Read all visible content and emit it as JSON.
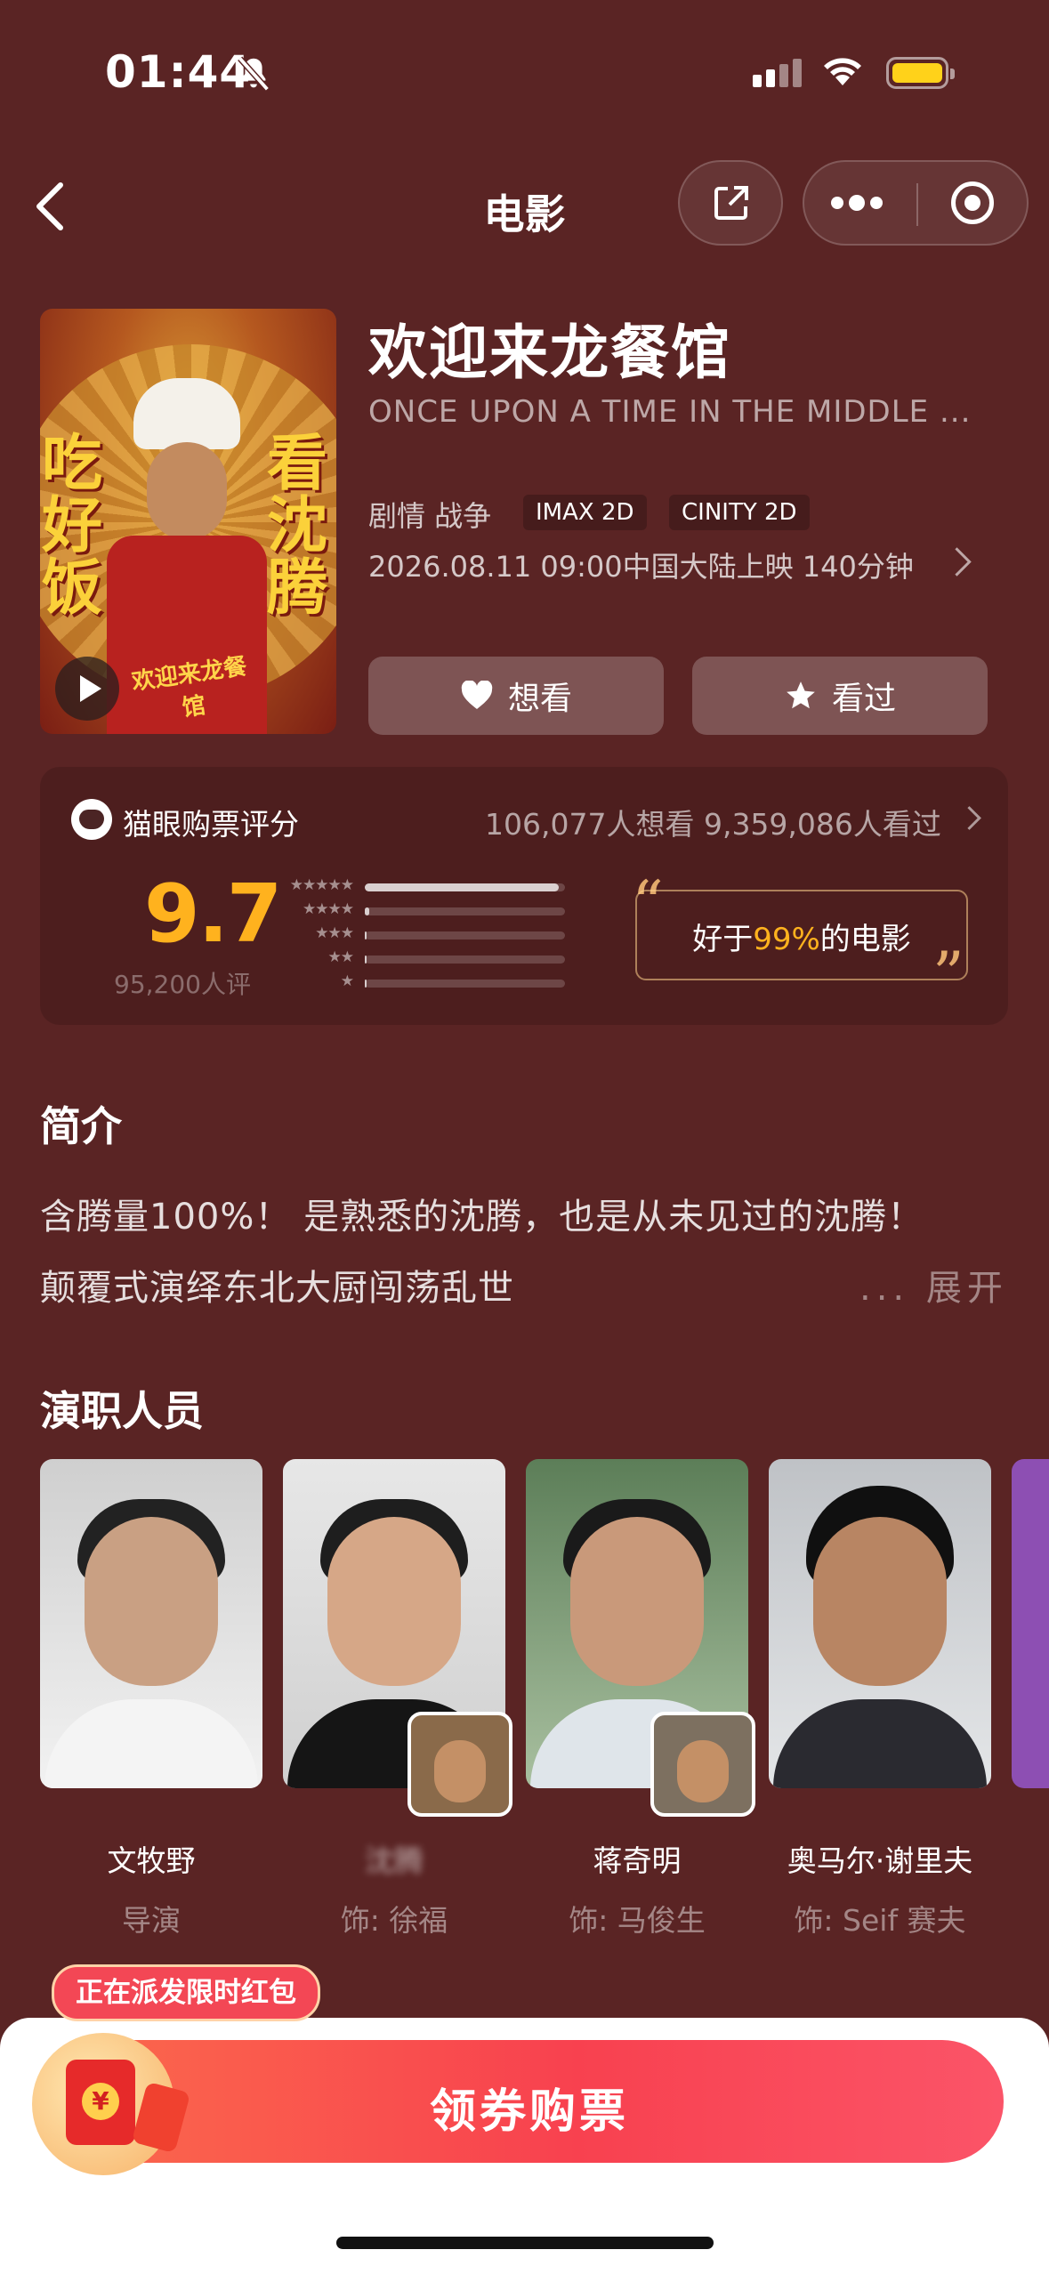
{
  "status_bar": {
    "time": "01:44"
  },
  "nav": {
    "title": "电影"
  },
  "movie": {
    "title": "欢迎来龙餐馆",
    "en_title": "ONCE UPON A TIME IN THE MIDDLE ...",
    "genres": "剧情 战争",
    "tags": [
      "IMAX 2D",
      "CINITY 2D"
    ],
    "release": "2026.08.11 09:00中国大陆上映 140分钟",
    "poster_text_left": "吃好饭",
    "poster_text_right": "看沈腾",
    "poster_text_center": "欢迎来龙餐馆"
  },
  "actions": {
    "want_label": "想看",
    "seen_label": "看过"
  },
  "rating": {
    "label": "猫眼购票评分",
    "counts": "106,077人想看 9,359,086人看过",
    "score": "9.7",
    "score_count": "95,200人评",
    "distribution": [
      0.97,
      0.02,
      0.005,
      0.003,
      0.002
    ],
    "star_labels": [
      "★★★★★",
      "★★★★",
      "★★★",
      "★★",
      "★"
    ],
    "better_prefix": "好于",
    "better_value": "99%",
    "better_suffix": "的电影"
  },
  "intro": {
    "heading": "简介",
    "line1": "含腾量100%！ 是熟悉的沈腾，也是从未见过的沈腾！",
    "line2": "颠覆式演绎东北大厨闯荡乱世",
    "expand": "... 展开"
  },
  "cast": {
    "heading": "演职人员",
    "members": [
      {
        "name": "文牧野",
        "role": "导演"
      },
      {
        "name": "沈腾",
        "role": "饰: 徐福"
      },
      {
        "name": "蒋奇明",
        "role": "饰: 马俊生"
      },
      {
        "name": "奥马尔·谢里夫",
        "role": "饰: Seif 赛夫"
      }
    ]
  },
  "bottom": {
    "promo": "正在派发限时红包",
    "buy_label": "领券购票",
    "yen": "¥"
  },
  "colors": {
    "background": "#5a2424",
    "score": "#ffb21e",
    "buy_button": "#f8414f"
  }
}
